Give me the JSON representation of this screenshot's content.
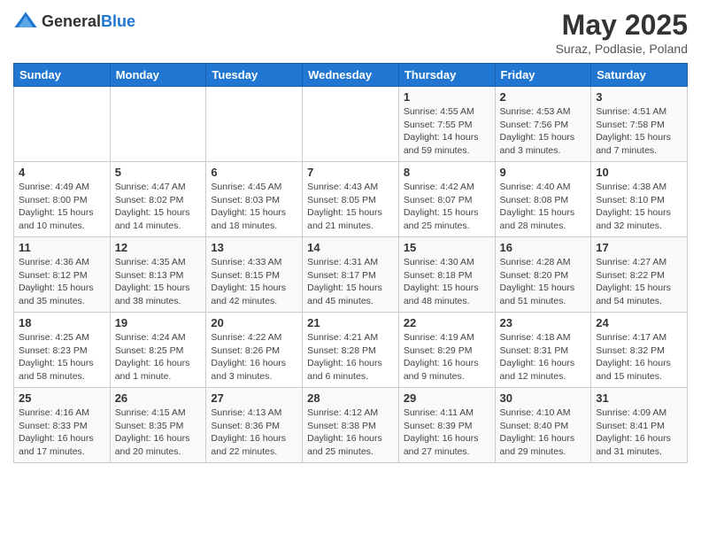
{
  "header": {
    "logo_general": "General",
    "logo_blue": "Blue",
    "title": "May 2025",
    "subtitle": "Suraz, Podlasie, Poland"
  },
  "weekdays": [
    "Sunday",
    "Monday",
    "Tuesday",
    "Wednesday",
    "Thursday",
    "Friday",
    "Saturday"
  ],
  "weeks": [
    [
      {
        "day": "",
        "info": ""
      },
      {
        "day": "",
        "info": ""
      },
      {
        "day": "",
        "info": ""
      },
      {
        "day": "",
        "info": ""
      },
      {
        "day": "1",
        "info": "Sunrise: 4:55 AM\nSunset: 7:55 PM\nDaylight: 14 hours and 59 minutes."
      },
      {
        "day": "2",
        "info": "Sunrise: 4:53 AM\nSunset: 7:56 PM\nDaylight: 15 hours and 3 minutes."
      },
      {
        "day": "3",
        "info": "Sunrise: 4:51 AM\nSunset: 7:58 PM\nDaylight: 15 hours and 7 minutes."
      }
    ],
    [
      {
        "day": "4",
        "info": "Sunrise: 4:49 AM\nSunset: 8:00 PM\nDaylight: 15 hours and 10 minutes."
      },
      {
        "day": "5",
        "info": "Sunrise: 4:47 AM\nSunset: 8:02 PM\nDaylight: 15 hours and 14 minutes."
      },
      {
        "day": "6",
        "info": "Sunrise: 4:45 AM\nSunset: 8:03 PM\nDaylight: 15 hours and 18 minutes."
      },
      {
        "day": "7",
        "info": "Sunrise: 4:43 AM\nSunset: 8:05 PM\nDaylight: 15 hours and 21 minutes."
      },
      {
        "day": "8",
        "info": "Sunrise: 4:42 AM\nSunset: 8:07 PM\nDaylight: 15 hours and 25 minutes."
      },
      {
        "day": "9",
        "info": "Sunrise: 4:40 AM\nSunset: 8:08 PM\nDaylight: 15 hours and 28 minutes."
      },
      {
        "day": "10",
        "info": "Sunrise: 4:38 AM\nSunset: 8:10 PM\nDaylight: 15 hours and 32 minutes."
      }
    ],
    [
      {
        "day": "11",
        "info": "Sunrise: 4:36 AM\nSunset: 8:12 PM\nDaylight: 15 hours and 35 minutes."
      },
      {
        "day": "12",
        "info": "Sunrise: 4:35 AM\nSunset: 8:13 PM\nDaylight: 15 hours and 38 minutes."
      },
      {
        "day": "13",
        "info": "Sunrise: 4:33 AM\nSunset: 8:15 PM\nDaylight: 15 hours and 42 minutes."
      },
      {
        "day": "14",
        "info": "Sunrise: 4:31 AM\nSunset: 8:17 PM\nDaylight: 15 hours and 45 minutes."
      },
      {
        "day": "15",
        "info": "Sunrise: 4:30 AM\nSunset: 8:18 PM\nDaylight: 15 hours and 48 minutes."
      },
      {
        "day": "16",
        "info": "Sunrise: 4:28 AM\nSunset: 8:20 PM\nDaylight: 15 hours and 51 minutes."
      },
      {
        "day": "17",
        "info": "Sunrise: 4:27 AM\nSunset: 8:22 PM\nDaylight: 15 hours and 54 minutes."
      }
    ],
    [
      {
        "day": "18",
        "info": "Sunrise: 4:25 AM\nSunset: 8:23 PM\nDaylight: 15 hours and 58 minutes."
      },
      {
        "day": "19",
        "info": "Sunrise: 4:24 AM\nSunset: 8:25 PM\nDaylight: 16 hours and 1 minute."
      },
      {
        "day": "20",
        "info": "Sunrise: 4:22 AM\nSunset: 8:26 PM\nDaylight: 16 hours and 3 minutes."
      },
      {
        "day": "21",
        "info": "Sunrise: 4:21 AM\nSunset: 8:28 PM\nDaylight: 16 hours and 6 minutes."
      },
      {
        "day": "22",
        "info": "Sunrise: 4:19 AM\nSunset: 8:29 PM\nDaylight: 16 hours and 9 minutes."
      },
      {
        "day": "23",
        "info": "Sunrise: 4:18 AM\nSunset: 8:31 PM\nDaylight: 16 hours and 12 minutes."
      },
      {
        "day": "24",
        "info": "Sunrise: 4:17 AM\nSunset: 8:32 PM\nDaylight: 16 hours and 15 minutes."
      }
    ],
    [
      {
        "day": "25",
        "info": "Sunrise: 4:16 AM\nSunset: 8:33 PM\nDaylight: 16 hours and 17 minutes."
      },
      {
        "day": "26",
        "info": "Sunrise: 4:15 AM\nSunset: 8:35 PM\nDaylight: 16 hours and 20 minutes."
      },
      {
        "day": "27",
        "info": "Sunrise: 4:13 AM\nSunset: 8:36 PM\nDaylight: 16 hours and 22 minutes."
      },
      {
        "day": "28",
        "info": "Sunrise: 4:12 AM\nSunset: 8:38 PM\nDaylight: 16 hours and 25 minutes."
      },
      {
        "day": "29",
        "info": "Sunrise: 4:11 AM\nSunset: 8:39 PM\nDaylight: 16 hours and 27 minutes."
      },
      {
        "day": "30",
        "info": "Sunrise: 4:10 AM\nSunset: 8:40 PM\nDaylight: 16 hours and 29 minutes."
      },
      {
        "day": "31",
        "info": "Sunrise: 4:09 AM\nSunset: 8:41 PM\nDaylight: 16 hours and 31 minutes."
      }
    ]
  ]
}
